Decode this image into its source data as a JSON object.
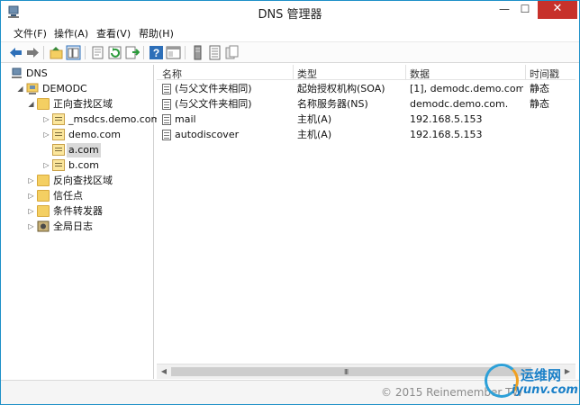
{
  "window": {
    "title": "DNS 管理器",
    "minimize": "—",
    "maximize": "☐",
    "close": "✕"
  },
  "menu": [
    "文件(F)",
    "操作(A)",
    "查看(V)",
    "帮助(H)"
  ],
  "toolbar": {
    "icons": [
      "back-arrow-icon",
      "forward-arrow-icon",
      "up-folder-icon",
      "show-hide-tree-icon",
      "properties-icon",
      "refresh-icon",
      "export-list-icon",
      "help-icon",
      "console-tree-icon",
      "server-icon",
      "records-icon"
    ]
  },
  "tree": [
    {
      "label": "DNS",
      "level": 0,
      "expander": "",
      "icon": "dns-server-icon"
    },
    {
      "label": "DEMODC",
      "level": 1,
      "expander": "◢",
      "icon": "server-icon"
    },
    {
      "label": "正向查找区域",
      "level": 2,
      "expander": "◢",
      "icon": "folder-icon"
    },
    {
      "label": "_msdcs.demo.com",
      "level": 3,
      "expander": "▷",
      "icon": "zone-icon"
    },
    {
      "label": "demo.com",
      "level": 3,
      "expander": "▷",
      "icon": "zone-icon"
    },
    {
      "label": "a.com",
      "level": 3,
      "expander": "",
      "icon": "zone-icon",
      "selected": true
    },
    {
      "label": "b.com",
      "level": 3,
      "expander": "▷",
      "icon": "zone-icon"
    },
    {
      "label": "反向查找区域",
      "level": 2,
      "expander": "▷",
      "icon": "folder-icon"
    },
    {
      "label": "信任点",
      "level": 2,
      "expander": "▷",
      "icon": "folder-icon"
    },
    {
      "label": "条件转发器",
      "level": 2,
      "expander": "▷",
      "icon": "folder-icon"
    },
    {
      "label": "全局日志",
      "level": 2,
      "expander": "▷",
      "icon": "event-log-icon"
    }
  ],
  "list": {
    "columns": [
      "名称",
      "类型",
      "数据",
      "时间戳"
    ],
    "rows": [
      [
        "(与父文件夹相同)",
        "起始授权机构(SOA)",
        "[1], demodc.demo.com....",
        "静态"
      ],
      [
        "(与父文件夹相同)",
        "名称服务器(NS)",
        "demodc.demo.com.",
        "静态"
      ],
      [
        "mail",
        "主机(A)",
        "192.168.5.153",
        ""
      ],
      [
        "autodiscover",
        "主机(A)",
        "192.168.5.153",
        ""
      ]
    ]
  },
  "scrollbar": {
    "left": "◀",
    "right": "▶",
    "grip": "III"
  },
  "watermark": "© 2015 Reinemember TW",
  "logo": {
    "cn": "运维网",
    "en": "iyunv.com"
  },
  "colors": {
    "accent": "#1e90c8",
    "close": "#c7312b",
    "folder": "#f4cf62",
    "selection": "#d9d9d9"
  }
}
